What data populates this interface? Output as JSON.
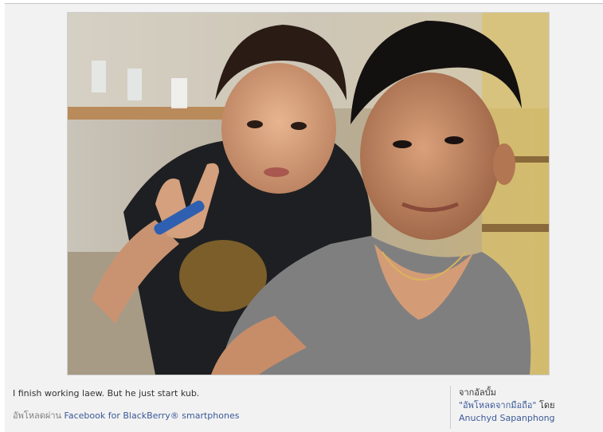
{
  "photo": {
    "alt": "Selfie of two young men"
  },
  "caption": "I finish working laew. But he just start kub.",
  "upload": {
    "prefix": "อัพโหลดผ่าน",
    "link": "Facebook for BlackBerry® smartphones"
  },
  "album": {
    "from_label": "จากอัลบั้ม",
    "album_name": "\"อัพโหลดจากมือถือ\"",
    "by_label": "โดย",
    "owner": "Anuchyd Sapanphong"
  },
  "colors": {
    "link": "#3b5998",
    "panel_bg": "#f2f2f2"
  }
}
